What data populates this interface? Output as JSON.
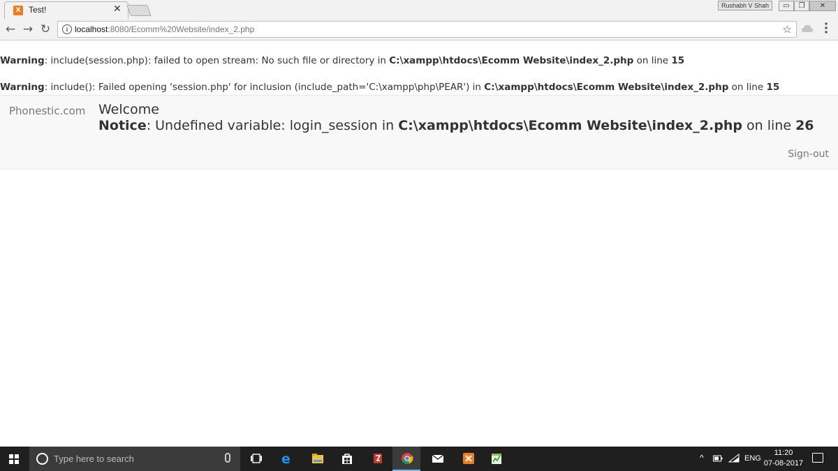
{
  "browser": {
    "tab_title": "Test!",
    "tab_close": "✕",
    "profile_name": "Rushabh V Shah",
    "url_host": "localhost",
    "url_path": ":8080/Ecomm%20Website/index_2.php",
    "info_glyph": "i",
    "star_glyph": "☆",
    "back_glyph": "←",
    "forward_glyph": "→",
    "reload_glyph": "↻",
    "min_glyph": "▭",
    "max_glyph": "❐",
    "close_glyph": "✕",
    "favicon_letter": "X"
  },
  "page": {
    "warning1": {
      "label": "Warning",
      "text": ": include(session.php): failed to open stream: No such file or directory in ",
      "path": "C:\\xampp\\htdocs\\Ecomm Website\\index_2.php",
      "on_line": " on line ",
      "line": "15"
    },
    "warning2": {
      "label": "Warning",
      "text": ": include(): Failed opening 'session.php' for inclusion (include_path='C:\\xampp\\php\\PEAR') in ",
      "path": "C:\\xampp\\htdocs\\Ecomm Website\\index_2.php",
      "on_line": " on line ",
      "line": "15"
    },
    "navbar": {
      "brand": "Phonestic.com",
      "welcome": "Welcome",
      "notice_label": "Notice",
      "notice_text": ": Undefined variable: login_session in ",
      "notice_path": "C:\\xampp\\htdocs\\Ecomm Website\\index_2.php",
      "notice_on_line": " on line ",
      "notice_line": "26",
      "signout": "Sign-out"
    }
  },
  "taskbar": {
    "search_placeholder": "Type here to search",
    "language": "ENG",
    "time": "11:20",
    "date": "07-08-2017",
    "tray_chevron": "^",
    "apps": [
      "task-view",
      "edge",
      "file-explorer",
      "store",
      "filezilla",
      "chrome",
      "mail",
      "xampp",
      "notepad-plus"
    ]
  }
}
